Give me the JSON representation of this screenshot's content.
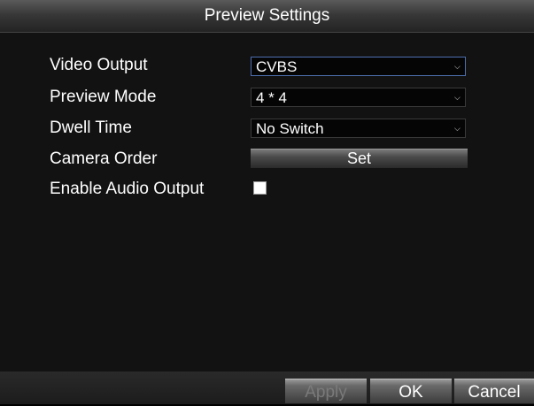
{
  "window": {
    "title": "Preview Settings"
  },
  "settings": {
    "video_output": {
      "label": "Video Output",
      "value": "CVBS"
    },
    "preview_mode": {
      "label": "Preview Mode",
      "value": "4 * 4"
    },
    "dwell_time": {
      "label": "Dwell Time",
      "value": "No Switch"
    },
    "camera_order": {
      "label": "Camera Order",
      "button_label": "Set"
    },
    "enable_audio_output": {
      "label": "Enable Audio Output",
      "checked": false
    }
  },
  "footer": {
    "apply_label": "Apply",
    "ok_label": "OK",
    "cancel_label": "Cancel"
  },
  "colors": {
    "focus_border": "#4d6fb0",
    "disabled_text": "#7a7a7a"
  }
}
